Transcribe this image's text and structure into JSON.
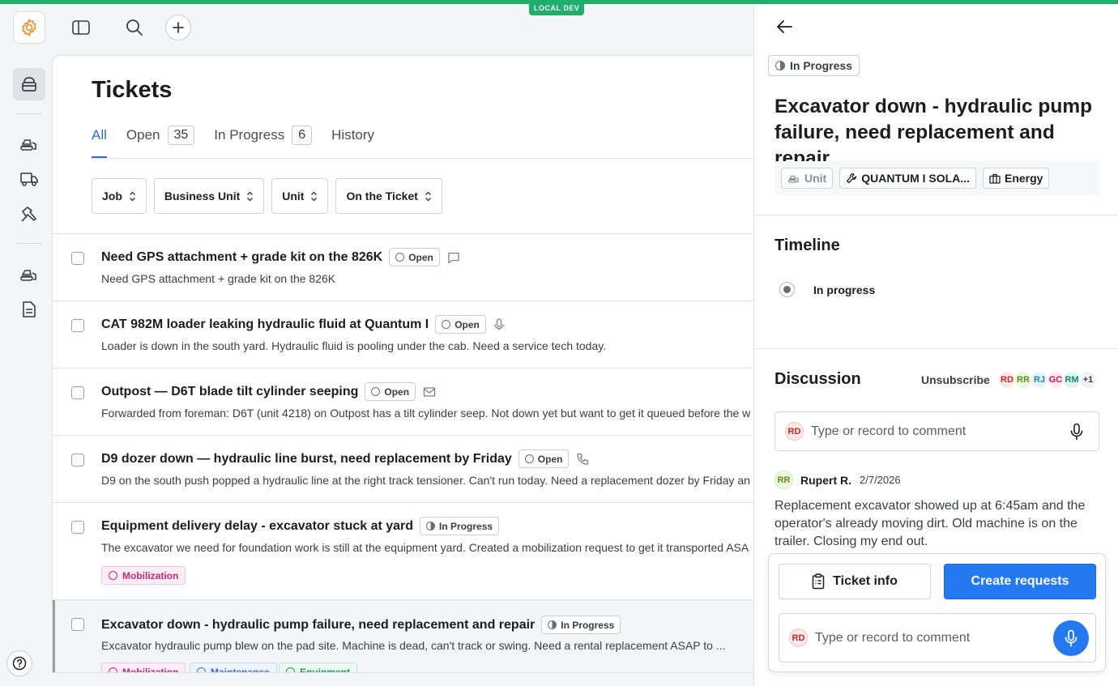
{
  "env_badge": "LOCAL DEV",
  "page": {
    "title": "Tickets",
    "tabs": [
      {
        "label": "All"
      },
      {
        "label": "Open",
        "count": "35"
      },
      {
        "label": "In Progress",
        "count": "6"
      },
      {
        "label": "History"
      }
    ],
    "filters": [
      "Job",
      "Business Unit",
      "Unit",
      "On the Ticket"
    ]
  },
  "tickets": [
    {
      "title": "Need GPS attachment + grade kit on the 826K",
      "status": "Open",
      "channel_icon": "chat-icon",
      "subtitle": "Need GPS attachment + grade kit on the 826K"
    },
    {
      "title": "CAT 982M loader leaking hydraulic fluid at Quantum I",
      "status": "Open",
      "channel_icon": "microphone-icon",
      "subtitle": "Loader is down in the south yard. Hydraulic fluid is pooling under the cab. Need a service tech today."
    },
    {
      "title": "Outpost — D6T blade tilt cylinder seeping",
      "status": "Open",
      "channel_icon": "mail-icon",
      "subtitle": "Forwarded from foreman: D6T (unit 4218) on Outpost has a tilt cylinder seep. Not down yet but want to get it queued before the w"
    },
    {
      "title": "D9 dozer down — hydraulic line burst, need replacement by Friday",
      "status": "Open",
      "channel_icon": "phone-icon",
      "subtitle": "D9 on the south push popped a hydraulic line at the right track tensioner. Can't run today. Need a replacement dozer by Friday an"
    },
    {
      "title": "Equipment delivery delay - excavator stuck at yard",
      "status": "In Progress",
      "subtitle": "The excavator we need for foundation work is still at the equipment yard. Created a mobilization request to get it transported ASA",
      "tags": [
        "Mobilization"
      ]
    },
    {
      "title": "Excavator down - hydraulic pump failure, need replacement and repair",
      "status": "In Progress",
      "subtitle": "Excavator hydraulic pump blew on the pad site. Machine is dead, can't track or swing. Need a rental replacement ASAP to ...",
      "tags": [
        "Mobilization",
        "Maintenance",
        "Equipment"
      ]
    }
  ],
  "detail": {
    "status": "In Progress",
    "title": "Excavator down - hydraulic pump failure, need replacement and repair",
    "meta": {
      "unit": "Unit",
      "job": "QUANTUM I SOLA...",
      "business_unit": "Energy"
    },
    "timeline_heading": "Timeline",
    "timeline": [
      {
        "label": "In progress"
      }
    ],
    "discussion_heading": "Discussion",
    "unsubscribe": "Unsubscribe",
    "subscribers": [
      {
        "initials": "RD",
        "bg": "#fde8e8",
        "fg": "#c62828"
      },
      {
        "initials": "RR",
        "bg": "#eef7e0",
        "fg": "#5a8f1e"
      },
      {
        "initials": "RJ",
        "bg": "#e3f4f7",
        "fg": "#1d8aa0"
      },
      {
        "initials": "GC",
        "bg": "#fde8ec",
        "fg": "#c2185b"
      },
      {
        "initials": "RM",
        "bg": "#e0f5f1",
        "fg": "#138a72"
      }
    ],
    "subscribers_more": "+1",
    "comment_placeholder": "Type or record to comment",
    "current_user": "RD",
    "comment": {
      "initials": "RR",
      "author": "Rupert R.",
      "date": "2/7/2026",
      "body": "Replacement excavator showed up at 6:45am and the operator's already moving dirt. Old machine is on the trailer. Closing my end out."
    },
    "actions": {
      "ticket_info": "Ticket info",
      "create_requests": "Create requests"
    }
  },
  "colors": {
    "accent": "#2478f0",
    "env": "#1fae6b",
    "brand": "#f08a24"
  }
}
